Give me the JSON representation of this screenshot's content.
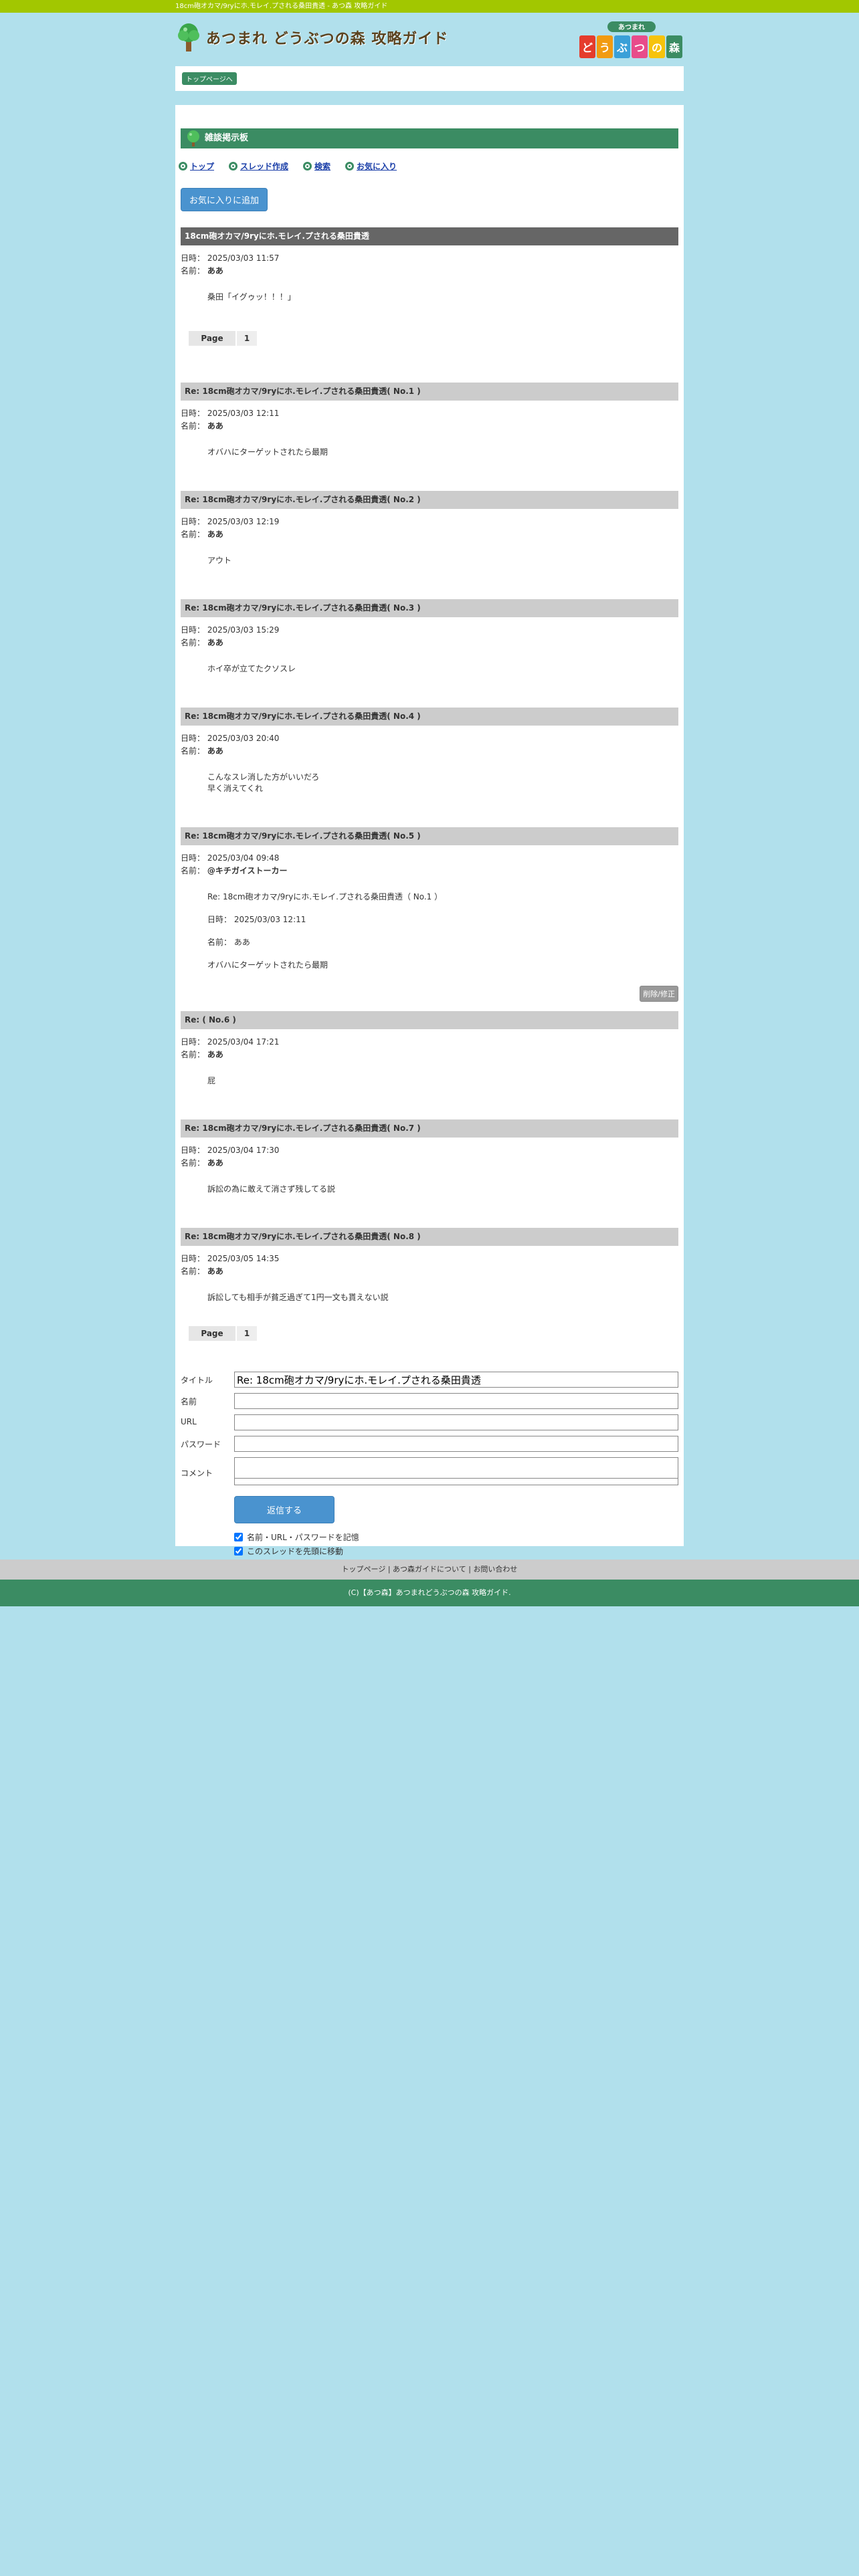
{
  "topbar": {
    "text": "18cm砲オカマ/9ryにホ.モレイ.プされる桑田貴透 - あつ森 攻略ガイド"
  },
  "header": {
    "site_title": "あつまれ どうぶつの森 攻略ガイド",
    "badge_top": "あつまれ",
    "badge_chars": [
      "ど",
      "う",
      "ぶ",
      "つ",
      "の",
      "森"
    ]
  },
  "breadcrumb": {
    "label": "トップページへ"
  },
  "board": {
    "title": "雑談掲示板"
  },
  "nav": [
    {
      "label": "トップ"
    },
    {
      "label": "スレッド作成"
    },
    {
      "label": "検索"
    },
    {
      "label": "お気に入り"
    }
  ],
  "fav_button": "お気に入りに追加",
  "meta_labels": {
    "date": "日時：",
    "name": "名前："
  },
  "first_post": {
    "title": "18cm砲オカマ/9ryにホ.モレイ.プされる桑田貴透",
    "date": "2025/03/03 11:57",
    "name": "ああ",
    "body": [
      "桑田「イグゥッ！！！」"
    ]
  },
  "pager": {
    "label": "Page",
    "page": "1"
  },
  "replies": [
    {
      "title": "Re: 18cm砲オカマ/9ryにホ.モレイ.プされる桑田貴透( No.1 )",
      "date": "2025/03/03 12:11",
      "name": "ああ",
      "body": [
        "オバハにターゲットされたら最期"
      ]
    },
    {
      "title": "Re: 18cm砲オカマ/9ryにホ.モレイ.プされる桑田貴透( No.2 )",
      "date": "2025/03/03 12:19",
      "name": "ああ",
      "body": [
        "アウト"
      ]
    },
    {
      "title": "Re: 18cm砲オカマ/9ryにホ.モレイ.プされる桑田貴透( No.3 )",
      "date": "2025/03/03 15:29",
      "name": "ああ",
      "body": [
        "ホイ卒が立てたクソスレ"
      ]
    },
    {
      "title": "Re: 18cm砲オカマ/9ryにホ.モレイ.プされる桑田貴透( No.4 )",
      "date": "2025/03/03 20:40",
      "name": "ああ",
      "body": [
        "こんなスレ消した方がいいだろ",
        "早く消えてくれ"
      ]
    },
    {
      "title": "Re: 18cm砲オカマ/9ryにホ.モレイ.プされる桑田貴透( No.5 )",
      "date": "2025/03/04 09:48",
      "name": "@キチガイストーカー",
      "body": [
        "Re: 18cm砲オカマ/9ryにホ.モレイ.プされる桑田貴透（ No.1 ）",
        "",
        "日時： 2025/03/03 12:11",
        "",
        "名前： ああ",
        "",
        "オバハにターゲットされたら最期"
      ],
      "quote_button": "削除/修正"
    },
    {
      "title": "Re: ( No.6 )",
      "date": "2025/03/04 17:21",
      "name": "ああ",
      "body": [
        "屁"
      ]
    },
    {
      "title": "Re: 18cm砲オカマ/9ryにホ.モレイ.プされる桑田貴透( No.7 )",
      "date": "2025/03/04 17:30",
      "name": "ああ",
      "body": [
        "訴訟の為に敢えて消さず残してる説"
      ]
    },
    {
      "title": "Re: 18cm砲オカマ/9ryにホ.モレイ.プされる桑田貴透( No.8 )",
      "date": "2025/03/05 14:35",
      "name": "ああ",
      "body": [
        "訴訟しても相手が貧乏過ぎて1円一文も貰えない説"
      ]
    }
  ],
  "form": {
    "title_label": "タイトル",
    "title_value": "Re: 18cm砲オカマ/9ryにホ.モレイ.プされる桑田貴透",
    "name_label": "名前",
    "url_label": "URL",
    "password_label": "パスワード",
    "comment_label": "コメント",
    "submit": "返信する",
    "remember": "名前・URL・パスワードを記憶",
    "move_top": "このスレッドを先頭に移動"
  },
  "footer": {
    "links": [
      "トップページ",
      "あつ森ガイドについて",
      "お問い合わせ"
    ],
    "separator": "|",
    "copyright": "(C)【あつ森】あつまれどうぶつの森 攻略ガイド."
  },
  "colors": {
    "brand_green": "#3b8c63",
    "top_bar": "#a2c700",
    "page_bg": "#b1e0ec",
    "button_blue": "#4a93cf"
  }
}
